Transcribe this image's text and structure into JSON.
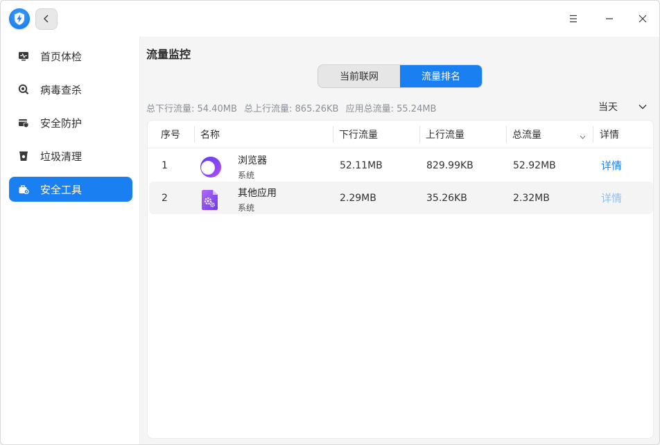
{
  "window": {
    "back_icon": "chevron-left-icon",
    "menu_icon": "menu-icon",
    "minimize_icon": "minimize-icon",
    "close_icon": "close-icon",
    "accent": "#1a7ff0"
  },
  "sidebar": {
    "items": [
      {
        "label": "首页体检",
        "icon": "monitor-pulse-icon"
      },
      {
        "label": "病毒查杀",
        "icon": "virus-scan-icon"
      },
      {
        "label": "安全防护",
        "icon": "protection-card-icon"
      },
      {
        "label": "垃圾清理",
        "icon": "trash-bin-icon"
      },
      {
        "label": "安全工具",
        "icon": "toolbox-icon",
        "active": true
      }
    ]
  },
  "main": {
    "title": "流量监控",
    "tabs": [
      {
        "label": "当前联网",
        "active": false
      },
      {
        "label": "流量排名",
        "active": true
      }
    ],
    "summary": {
      "download": "总下行流量: 54.40MB",
      "upload": "总上行流量: 865.26KB",
      "total": "应用总流量: 55.24MB"
    },
    "range": {
      "value": "当天",
      "icon": "chevron-down-icon"
    },
    "table": {
      "columns": {
        "index": "序号",
        "name": "名称",
        "download": "下行流量",
        "upload": "上行流量",
        "total": "总流量",
        "detail": "详情"
      },
      "sort_icon": "sort-down-icon",
      "rows": [
        {
          "index": "1",
          "name": "浏览器",
          "type": "系统",
          "download": "52.11MB",
          "upload": "829.99KB",
          "total": "52.92MB",
          "detail": "详情",
          "icon": "browser-icon"
        },
        {
          "index": "2",
          "name": "其他应用",
          "type": "系统",
          "download": "2.29MB",
          "upload": "35.26KB",
          "total": "2.32MB",
          "detail": "详情",
          "icon": "other-apps-gear-icon"
        }
      ]
    }
  }
}
